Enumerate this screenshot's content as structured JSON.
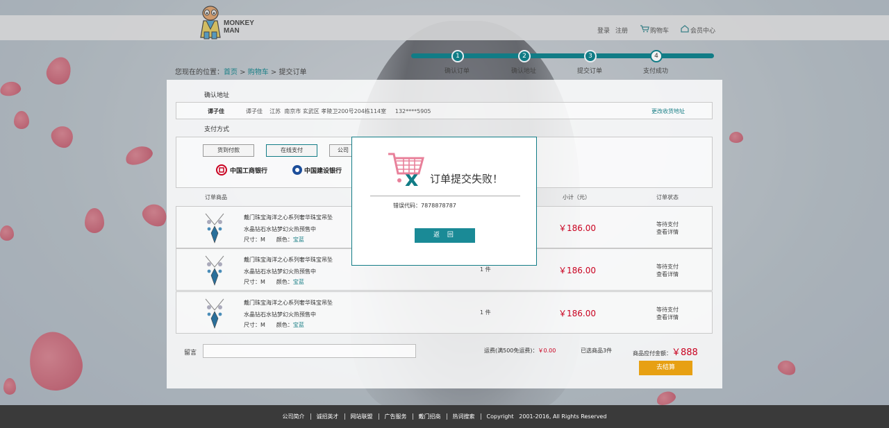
{
  "logo": {
    "line1": "MONKEY",
    "line2": "MAN"
  },
  "topnav": {
    "login": "登录",
    "register": "注册",
    "cart": "购物车",
    "member": "会员中心"
  },
  "breadcrumb": {
    "prefix": "您现在的位置：",
    "home": "首页",
    "sep1": " > ",
    "cart": "购物车",
    "sep2": " > ",
    "current": "提交订单"
  },
  "steps": [
    {
      "num": "1",
      "label": "确认订单"
    },
    {
      "num": "2",
      "label": "确认地址"
    },
    {
      "num": "3",
      "label": "提交订单"
    },
    {
      "num": "4",
      "label": "支付成功"
    }
  ],
  "address": {
    "section_title": "确认地址",
    "name": "谭子佳",
    "detail": "谭子佳    江苏  南京市 玄武区 孝陵卫200号204栋114室     132****5905",
    "change_link": "更改收货地址"
  },
  "payment": {
    "section_title": "支付方式",
    "cod": "货到付款",
    "online": "在线支付",
    "other": "公司",
    "bank1": "中国工商银行",
    "bank2": "中国建设银行"
  },
  "table": {
    "col_product": "订单商品",
    "col_subtotal": "小计（元）",
    "col_status": "订单状态",
    "rows": [
      {
        "name1": "戴门珠宝海洋之心系列奢华珠宝吊坠",
        "name2": "水晶钻石水钻梦幻火热预售中",
        "size_label": "尺寸：",
        "size": "M",
        "color_label": "颜色：",
        "color": "宝蓝",
        "qty": "",
        "price": "￥186.00",
        "status": "等待支付",
        "detail": "查看详情"
      },
      {
        "name1": "戴门珠宝海洋之心系列奢华珠宝吊坠",
        "name2": "水晶钻石水钻梦幻火热预售中",
        "size_label": "尺寸：",
        "size": "M",
        "color_label": "颜色：",
        "color": "宝蓝",
        "qty": "1 件",
        "price": "￥186.00",
        "status": "等待支付",
        "detail": "查看详情"
      },
      {
        "name1": "戴门珠宝海洋之心系列奢华珠宝吊坠",
        "name2": "水晶钻石水钻梦幻火热预售中",
        "size_label": "尺寸：",
        "size": "M",
        "color_label": "颜色：",
        "color": "宝蓝",
        "qty": "1 件",
        "price": "￥186.00",
        "status": "等待支付",
        "detail": "查看详情"
      }
    ]
  },
  "summary": {
    "memo_label": "留言",
    "shipping_label": "运费(满500免运费)：",
    "shipping_value": "￥0.00",
    "selected": "已选商品3件",
    "total_label": "商品应付金额：",
    "total_value": "￥888",
    "checkout": "去结算"
  },
  "modal": {
    "title": "订单提交失败！",
    "error": "错误代码：7878878787",
    "back": "返 回"
  },
  "footer": {
    "links": [
      "公司简介",
      "诚招英才",
      "网站联盟",
      "广告服务",
      "戴门招商",
      "热词搜索"
    ],
    "copyright": "Copyright   2001-2016, All Rights Reserved"
  },
  "colors": {
    "accent": "#117c86",
    "price": "#c9001f",
    "checkout": "#e7a013",
    "cart_icon": "#e8809a"
  }
}
